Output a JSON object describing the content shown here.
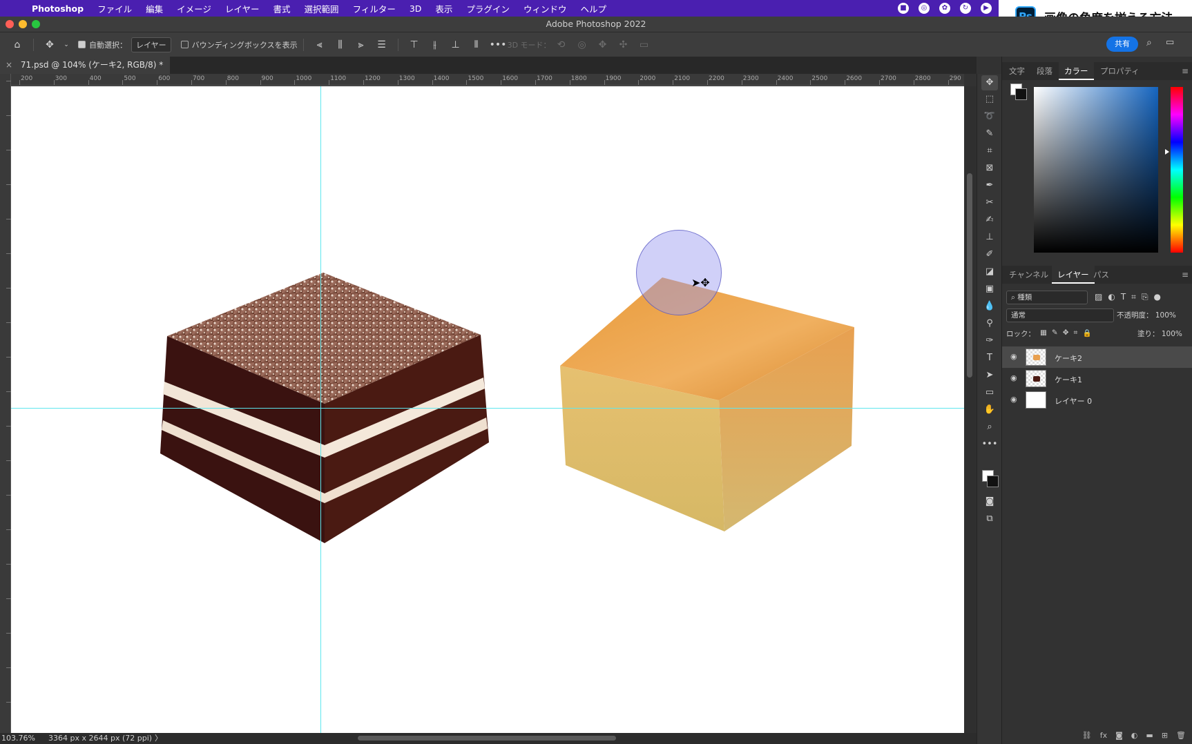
{
  "menubar": {
    "app": "Photoshop",
    "items": [
      "ファイル",
      "編集",
      "イメージ",
      "レイヤー",
      "書式",
      "選択範囲",
      "フィルター",
      "3D",
      "表示",
      "プラグイン",
      "ウィンドウ",
      "ヘルプ"
    ]
  },
  "window": {
    "title": "Adobe Photoshop 2022"
  },
  "banner": {
    "logo": "Ps",
    "text": "画像の角度を揃える方法"
  },
  "options": {
    "auto_select_label": "自動選択：",
    "auto_select_target": "レイヤー",
    "bbox_label": "バウンディングボックスを表示",
    "mode_3d": "3D モード：",
    "share": "共有"
  },
  "document": {
    "tab": "71.psd @ 104% (ケーキ2, RGB/8) *"
  },
  "ruler": {
    "labels": [
      "200",
      "300",
      "400",
      "500",
      "600",
      "700",
      "800",
      "900",
      "1000",
      "1100",
      "1200",
      "1300",
      "1400",
      "1500",
      "1600",
      "1700",
      "1800",
      "1900",
      "2000",
      "2100",
      "2200",
      "2300",
      "2400",
      "2500",
      "2600",
      "2700",
      "2800",
      "290"
    ]
  },
  "status": {
    "zoom": "103.76%",
    "dimensions": "3364 px x 2644 px (72 ppi)",
    "arrow": "〉"
  },
  "panels": {
    "top_tabs": [
      "文字",
      "段落",
      "カラー",
      "プロパティ"
    ],
    "active_top": "カラー",
    "layer_tabs": [
      "チャンネル",
      "レイヤー",
      "パス"
    ],
    "active_layer_tab": "レイヤー",
    "filter_kind": "種類",
    "blend_mode": "通常",
    "opacity_label": "不透明度：",
    "opacity_value": "100%",
    "lock_label": "ロック：",
    "fill_label": "塗り：",
    "fill_value": "100%",
    "layers": [
      {
        "name": "ケーキ2",
        "selected": true
      },
      {
        "name": "ケーキ1",
        "selected": false
      },
      {
        "name": "レイヤー 0",
        "selected": false
      }
    ]
  }
}
